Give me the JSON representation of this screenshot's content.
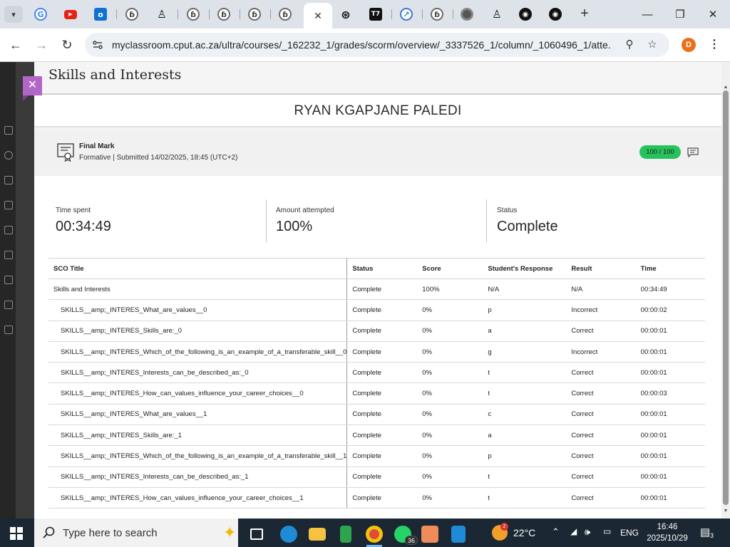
{
  "browser": {
    "tabs": [
      {
        "icon": "google-icon"
      },
      {
        "icon": "youtube-icon"
      },
      {
        "icon": "outlook-icon"
      },
      {
        "icon": "ai-tutor-icon"
      },
      {
        "icon": "microscope-icon"
      },
      {
        "icon": "ai-tutor-icon"
      },
      {
        "icon": "ai-tutor-icon"
      },
      {
        "icon": "ai-tutor-icon"
      },
      {
        "icon": "ai-tutor-icon"
      },
      {
        "icon": "close-icon",
        "active": true
      },
      {
        "icon": "openai-icon"
      },
      {
        "icon": "tt-icon"
      },
      {
        "icon": "copilot-icon"
      },
      {
        "icon": "ai-tutor-icon"
      },
      {
        "icon": "chrome-icon"
      },
      {
        "icon": "microscope-icon"
      },
      {
        "icon": "github-icon"
      },
      {
        "icon": "github-icon"
      }
    ],
    "url": "myclassroom.cput.ac.za/ultra/courses/_162232_1/grades/scorm/overview/_3337526_1/column/_1060496_1/atte...",
    "profile_initial": "D"
  },
  "panel": {
    "title": "Skills and Interests",
    "student_name": "RYAN KGAPJANE PALEDI",
    "final_mark": {
      "title": "Final Mark",
      "subtitle": "Formative  |  Submitted 14/02/2025, 18:45 (UTC+2)",
      "score": "100 / 100"
    },
    "stats": {
      "time_spent_label": "Time spent",
      "time_spent": "00:34:49",
      "amount_label": "Amount attempted",
      "amount": "100%",
      "status_label": "Status",
      "status": "Complete"
    },
    "table": {
      "headers": [
        "SCO Title",
        "Status",
        "Score",
        "Student's Response",
        "Result",
        "Time"
      ],
      "rows": [
        [
          "Skills and Interests",
          "Complete",
          "100%",
          "N/A",
          "N/A",
          "00:34:49"
        ],
        [
          "SKILLS__amp;_INTERES_What_are_values__0",
          "Complete",
          "0%",
          "p",
          "Incorrect",
          "00:00:02"
        ],
        [
          "SKILLS__amp;_INTERES_Skills_are:_0",
          "Complete",
          "0%",
          "a",
          "Correct",
          "00:00:01"
        ],
        [
          "SKILLS__amp;_INTERES_Which_of_the_following_is_an_example_of_a_transferable_skill__0",
          "Complete",
          "0%",
          "g",
          "Incorrect",
          "00:00:01"
        ],
        [
          "SKILLS__amp;_INTERES_Interests_can_be_described_as:_0",
          "Complete",
          "0%",
          "t",
          "Correct",
          "00:00:01"
        ],
        [
          "SKILLS__amp;_INTERES_How_can_values_influence_your_career_choices__0",
          "Complete",
          "0%",
          "t",
          "Correct",
          "00:00:03"
        ],
        [
          "SKILLS__amp;_INTERES_What_are_values__1",
          "Complete",
          "0%",
          "c",
          "Correct",
          "00:00:01"
        ],
        [
          "SKILLS__amp;_INTERES_Skills_are:_1",
          "Complete",
          "0%",
          "a",
          "Correct",
          "00:00:01"
        ],
        [
          "SKILLS__amp;_INTERES_Which_of_the_following_is_an_example_of_a_transferable_skill__1",
          "Complete",
          "0%",
          "p",
          "Correct",
          "00:00:01"
        ],
        [
          "SKILLS__amp;_INTERES_Interests_can_be_described_as:_1",
          "Complete",
          "0%",
          "t",
          "Correct",
          "00:00:01"
        ],
        [
          "SKILLS__amp;_INTERES_How_can_values_influence_your_career_choices__1",
          "Complete",
          "0%",
          "t",
          "Correct",
          "00:00:01"
        ]
      ]
    }
  },
  "taskbar": {
    "search_placeholder": "Type here to search",
    "whatsapp_badge": "36",
    "weather_badge": "2",
    "temperature": "22°C",
    "language": "ENG",
    "time": "16:46",
    "date": "2025/10/29",
    "notification_count": "3"
  },
  "colors": {
    "score_pill": "#26c35c",
    "close_button": "#b266c8",
    "taskbar": "#1b2732",
    "profile": "#e8711a"
  }
}
